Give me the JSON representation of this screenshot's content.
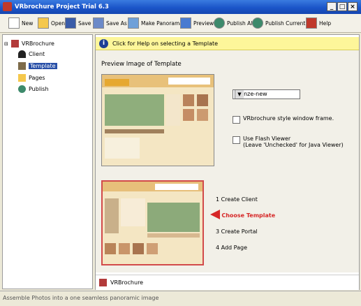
{
  "window": {
    "title": "VRbrochure Project Trial 6.3",
    "minimize": "_",
    "maximize": "□",
    "close": "×"
  },
  "toolbar": {
    "new": "New",
    "open": "Open",
    "save": "Save",
    "save_as": "Save As",
    "make_panorama": "Make Panorama",
    "preview": "Preview",
    "publish_all": "Publish All",
    "publish_current": "Publish Current",
    "help": "Help"
  },
  "tree": {
    "root": "VRBrochure",
    "items": [
      "Client",
      "Template",
      "Pages",
      "Publish"
    ],
    "selected": "Template"
  },
  "help": {
    "text": "Click for Help on selecting a Template"
  },
  "main": {
    "preview_title": "Preview Image of Template",
    "template_select": "bronze-new",
    "vr_frame_label": "VRbrochure style window frame.",
    "flash_label": "Use Flash Viewer",
    "flash_note": "(Leave 'Unchecked' for Java Viewer)"
  },
  "steps": [
    "1 Create Client",
    "2 Choose Template",
    "3 Create Portal",
    "4 Add Page"
  ],
  "bottom": {
    "label": "VRBrochure"
  },
  "status": {
    "text": "Assemble Photos into a one seamless panoramic image"
  },
  "colors": {
    "titlebar": "#1b55c9",
    "selection": "#2950a8",
    "helpbar": "#fdf69a",
    "active_step": "#d62727"
  }
}
